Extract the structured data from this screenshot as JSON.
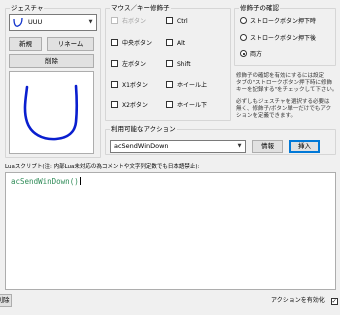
{
  "gesture": {
    "title": "ジェスチャ",
    "selected": "UUU",
    "new_label": "新規",
    "rename_label": "リネーム",
    "delete_label": "削除"
  },
  "modifiers": {
    "title": "マウス／キー修飾子",
    "items": [
      {
        "label": "右ボタン",
        "checked": false,
        "disabled": true
      },
      {
        "label": "Ctrl",
        "checked": false,
        "disabled": false
      },
      {
        "label": "中央ボタン",
        "checked": false,
        "disabled": false
      },
      {
        "label": "Alt",
        "checked": false,
        "disabled": false
      },
      {
        "label": "左ボタン",
        "checked": false,
        "disabled": false
      },
      {
        "label": "Shift",
        "checked": false,
        "disabled": false
      },
      {
        "label": "X1ボタン",
        "checked": false,
        "disabled": false
      },
      {
        "label": "ホイール上",
        "checked": false,
        "disabled": false
      },
      {
        "label": "X2ボタン",
        "checked": false,
        "disabled": false
      },
      {
        "label": "ホイール下",
        "checked": false,
        "disabled": false
      }
    ]
  },
  "confirm": {
    "title": "修飾子の確認",
    "options": [
      {
        "label": "ストロークボタン押下時",
        "selected": false
      },
      {
        "label": "ストロークボタン押下後",
        "selected": false
      },
      {
        "label": "両方",
        "selected": true
      }
    ]
  },
  "description": {
    "line1": "修飾子の確認を有効にするには設定",
    "line2": "タブの\"ストロークボタン押下時に修飾",
    "line3": "キーを記録する\"をチェックして下さい。",
    "line4": "必ずしもジェスチャを選択する必要は",
    "line5": "無く、修飾子/ボタン単一だけでもアク",
    "line6": "ションを定義できます。"
  },
  "actions": {
    "title": "利用可能なアクション",
    "selected": "acSendWinDown",
    "info_label": "情報",
    "insert_label": "挿入"
  },
  "script": {
    "label": "Luaスクリプト(注: 内部Lua未対応の為コメントや文字列定数でも日本語禁止):",
    "code": "acSendWinDown()"
  },
  "footer": {
    "delete_label": "削除",
    "enable_label": "アクションを有効化",
    "enable_checked": true
  },
  "colors": {
    "stroke": "#0a1fcf",
    "code": "#2e8b57",
    "accent": "#0078d7"
  },
  "icons": {
    "gesture_preview": "gesture-stroke-icon",
    "dropdown": "chevron-down-icon"
  }
}
